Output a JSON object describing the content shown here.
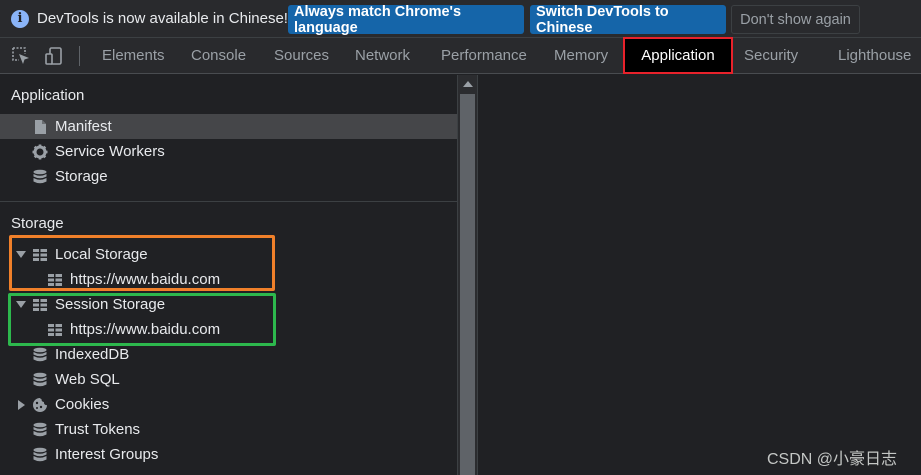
{
  "infobar": {
    "message": "DevTools is now available in Chinese!",
    "buttons": {
      "match_language": "Always match Chrome's language",
      "switch_chinese": "Switch DevTools to Chinese",
      "dont_show": "Don't show again"
    }
  },
  "tabs": [
    {
      "label": "Elements"
    },
    {
      "label": "Console"
    },
    {
      "label": "Sources"
    },
    {
      "label": "Network"
    },
    {
      "label": "Performance"
    },
    {
      "label": "Memory"
    },
    {
      "label": "Application",
      "selected": true
    },
    {
      "label": "Security"
    },
    {
      "label": "Lighthouse"
    }
  ],
  "sidebar": {
    "application_section": {
      "title": "Application",
      "items": [
        {
          "label": "Manifest",
          "icon": "document-icon",
          "selected": true
        },
        {
          "label": "Service Workers",
          "icon": "gear-icon"
        },
        {
          "label": "Storage",
          "icon": "database-icon"
        }
      ]
    },
    "storage_section": {
      "title": "Storage",
      "local_storage": {
        "label": "Local Storage",
        "icon": "table-icon",
        "child": "https://www.baidu.com"
      },
      "session_storage": {
        "label": "Session Storage",
        "icon": "table-icon",
        "child": "https://www.baidu.com"
      },
      "indexeddb": {
        "label": "IndexedDB",
        "icon": "database-icon"
      },
      "websql": {
        "label": "Web SQL",
        "icon": "database-icon"
      },
      "cookies": {
        "label": "Cookies",
        "icon": "cookie-icon"
      },
      "trust_tokens": {
        "label": "Trust Tokens",
        "icon": "database-icon"
      },
      "interest_groups": {
        "label": "Interest Groups",
        "icon": "database-icon"
      }
    }
  },
  "annotations": {
    "orange_highlight_color": "#f0802a",
    "green_highlight_color": "#2db84d",
    "red_highlight_color": "#e8222b"
  },
  "watermark": "CSDN @小豪日志"
}
